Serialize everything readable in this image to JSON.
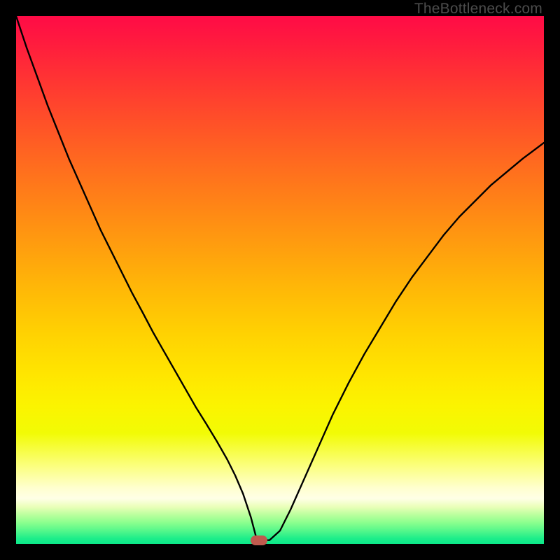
{
  "watermark": "TheBottleneck.com",
  "colors": {
    "frame": "#000000",
    "curve": "#000000",
    "marker": "#c05a4e"
  },
  "chart_data": {
    "type": "line",
    "title": "",
    "xlabel": "",
    "ylabel": "",
    "xlim": [
      0,
      100
    ],
    "ylim": [
      0,
      100
    ],
    "grid": false,
    "legend": false,
    "series": [
      {
        "name": "bottleneck-curve",
        "x": [
          0.0,
          2.0,
          4.0,
          6.0,
          8.0,
          10.0,
          12.0,
          14.0,
          16.0,
          18.0,
          20.0,
          22.0,
          24.0,
          26.0,
          28.0,
          30.0,
          32.0,
          34.0,
          36.0,
          38.0,
          40.0,
          41.5,
          43.0,
          44.5,
          45.5,
          46.5,
          48.0,
          50.0,
          52.0,
          54.0,
          56.0,
          58.0,
          60.0,
          63.0,
          66.0,
          69.0,
          72.0,
          75.0,
          78.0,
          81.0,
          84.0,
          87.0,
          90.0,
          93.0,
          96.0,
          100.0
        ],
        "y": [
          100.0,
          94.0,
          88.5,
          83.0,
          78.0,
          73.0,
          68.5,
          64.0,
          59.5,
          55.5,
          51.5,
          47.5,
          43.8,
          40.0,
          36.5,
          33.0,
          29.5,
          26.0,
          22.8,
          19.5,
          16.0,
          13.0,
          9.5,
          5.0,
          1.2,
          0.7,
          0.7,
          2.5,
          6.5,
          11.0,
          15.5,
          20.0,
          24.5,
          30.5,
          36.0,
          41.0,
          46.0,
          50.5,
          54.5,
          58.5,
          62.0,
          65.0,
          68.0,
          70.5,
          73.0,
          76.0
        ]
      }
    ],
    "annotations": [
      {
        "type": "marker",
        "shape": "pill",
        "x": 46.0,
        "y": 0.7,
        "color": "#c05a4e"
      }
    ],
    "background_gradient": {
      "direction": "vertical",
      "stops": [
        {
          "pos": 0.0,
          "color": "#ff0b46"
        },
        {
          "pos": 0.5,
          "color": "#ffb400"
        },
        {
          "pos": 0.78,
          "color": "#f5fb00"
        },
        {
          "pos": 0.9,
          "color": "#ffffd8"
        },
        {
          "pos": 1.0,
          "color": "#0be889"
        }
      ]
    }
  }
}
